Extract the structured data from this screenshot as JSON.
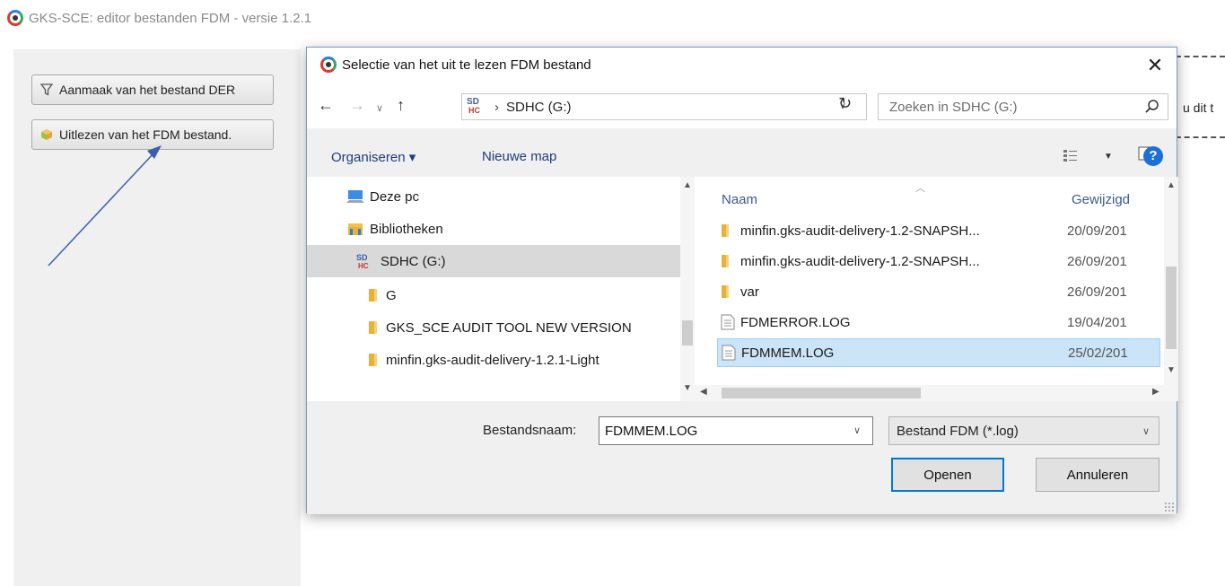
{
  "app": {
    "title": "GKS-SCE: editor bestanden FDM - versie 1.2.1",
    "buttons": [
      {
        "label": "Aanmaak van het bestand DER",
        "icon": "funnel-icon"
      },
      {
        "label": "Uitlezen van het FDM bestand.",
        "icon": "box-icon"
      }
    ],
    "behind_text": "u dit t"
  },
  "dialog": {
    "title": "Selectie van het uit te lezen FDM bestand",
    "close_label": "✕",
    "address": {
      "location": "SDHC (G:)",
      "separator": "›"
    },
    "search_placeholder": "Zoeken in SDHC (G:)",
    "toolbar": {
      "organize": "Organiseren ▾",
      "new_folder": "Nieuwe map",
      "help": "?"
    },
    "nav_items": [
      {
        "label": "Deze pc",
        "icon": "computer-icon",
        "indent": 1
      },
      {
        "label": "Bibliotheken",
        "icon": "library-icon",
        "indent": 1
      },
      {
        "label": "SDHC (G:)",
        "icon": "sd-card-icon",
        "indent": 1,
        "selected": true
      },
      {
        "label": "G",
        "icon": "folder-icon",
        "indent": 2
      },
      {
        "label": "GKS_SCE AUDIT TOOL NEW VERSION",
        "icon": "folder-icon",
        "indent": 2
      },
      {
        "label": "minfin.gks-audit-delivery-1.2.1-Light",
        "icon": "folder-icon",
        "indent": 2
      }
    ],
    "columns": {
      "name": "Naam",
      "modified": "Gewijzigd"
    },
    "files": [
      {
        "name": "minfin.gks-audit-delivery-1.2-SNAPSH...",
        "date": "20/09/201",
        "icon": "folder-icon"
      },
      {
        "name": "minfin.gks-audit-delivery-1.2-SNAPSH...",
        "date": "26/09/201",
        "icon": "folder-icon"
      },
      {
        "name": "var",
        "date": "26/09/201",
        "icon": "folder-icon"
      },
      {
        "name": "FDMERROR.LOG",
        "date": "19/04/201",
        "icon": "text-file-icon"
      },
      {
        "name": "FDMMEM.LOG",
        "date": "25/02/201",
        "icon": "text-file-icon",
        "selected": true
      }
    ],
    "filename_label": "Bestandsnaam:",
    "filename_value": "FDMMEM.LOG",
    "filetype": "Bestand FDM (*.log)",
    "open_label": "Openen",
    "cancel_label": "Annuleren"
  },
  "colors": {
    "accent": "#0078d7",
    "selection": "#cce4f7",
    "annotation_arrow": "#3b5fb0"
  }
}
